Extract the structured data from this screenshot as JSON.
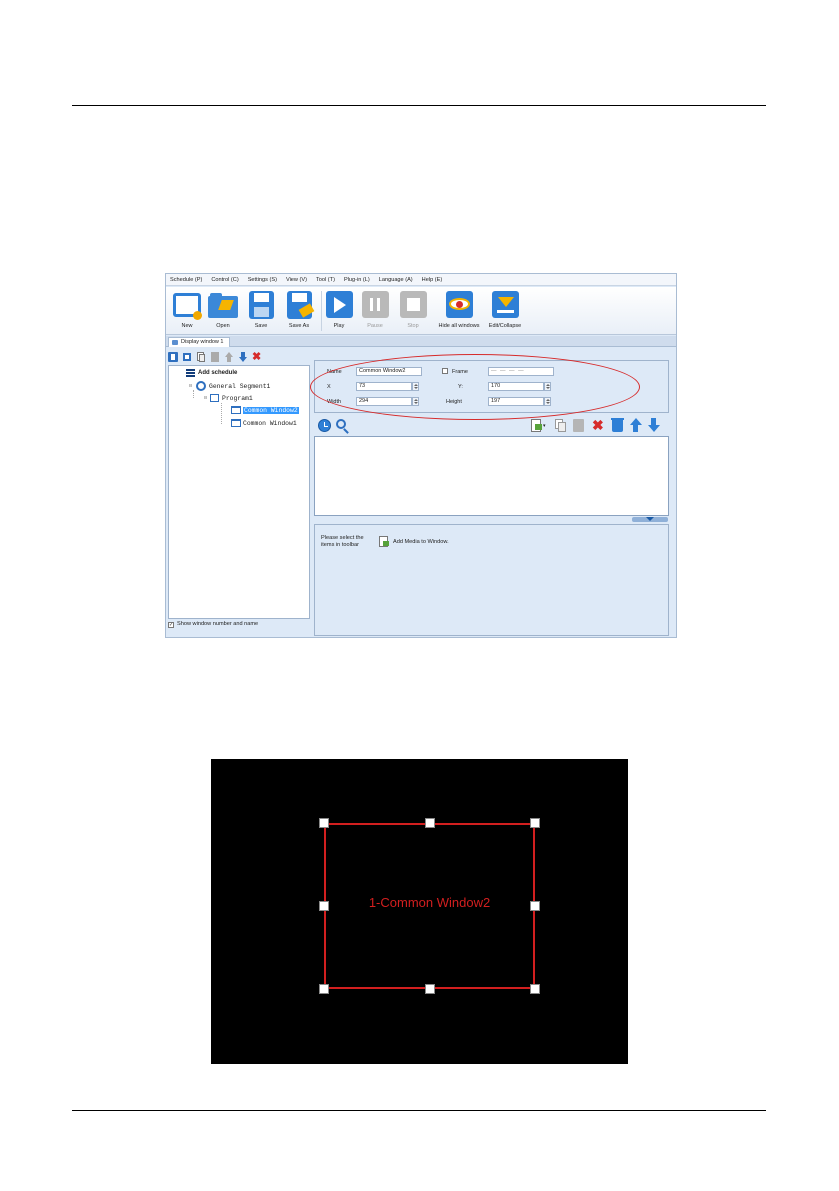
{
  "app": {
    "menu": [
      "Schedule (P)",
      "Control (C)",
      "Settings (S)",
      "View (V)",
      "Tool (T)",
      "Plug-in (L)",
      "Language (A)",
      "Help (E)"
    ],
    "toolbar": {
      "new": "New",
      "open": "Open",
      "save": "Save",
      "save_as": "Save As",
      "play": "Play",
      "pause": "Pause",
      "stop": "Stop",
      "hide_all_windows": "Hide all windows",
      "edit_collapse": "Edit/Collapse"
    },
    "tab": "Display window 1",
    "tree": {
      "add_schedule": "Add schedule",
      "segment": "General Segment1",
      "program": "Program1",
      "window2": "Common Window2",
      "window1": "Common Window1"
    },
    "show_window_number": "Show window number and name",
    "show_window_number_checked": true,
    "props": {
      "name_label": "Name",
      "name_value": "Common Window2",
      "frame_label": "Frame",
      "x_label": "X",
      "x_value": "73",
      "y_label": "Y:",
      "y_value": "170",
      "width_label": "Width",
      "width_value": "294",
      "height_label": "Height",
      "height_value": "197"
    },
    "bottom": {
      "hint": "Please select the items in toolbar",
      "add_media": "Add Media to Window."
    },
    "colors": {
      "accent": "#2e7fd6",
      "highlight": "#d62b2b",
      "selection": "#3399ff"
    }
  },
  "preview": {
    "window_label": "1-Common Window2",
    "colors": {
      "background": "#000000",
      "border": "#d21f1f"
    }
  }
}
